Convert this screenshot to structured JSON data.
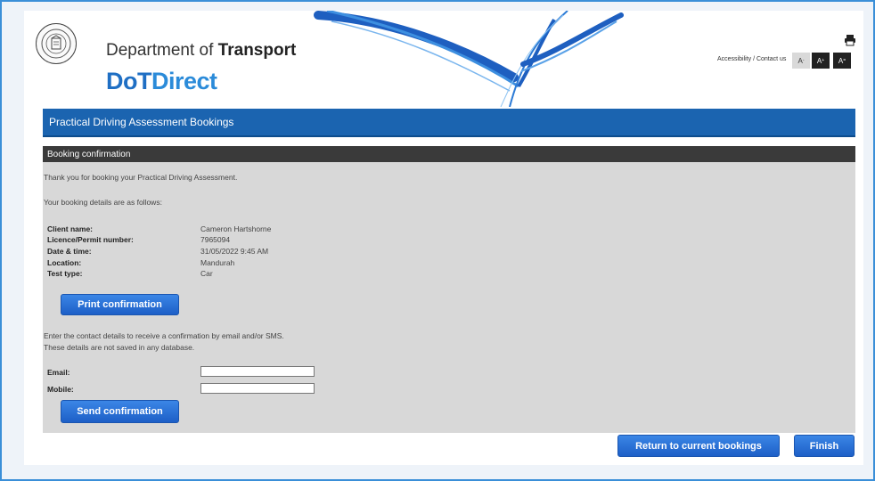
{
  "header": {
    "dept_prefix": "Department of ",
    "dept_bold": "Transport",
    "brand_dot": "DoT",
    "brand_direct": "Direct",
    "accessibility_link": "Accessibility / Contact us",
    "font_small": "A",
    "font_large": "A",
    "font_reset": "A"
  },
  "page_title": "Practical Driving Assessment Bookings",
  "section_title": "Booking confirmation",
  "intro": "Thank you for booking your Practical Driving Assessment.",
  "details_intro": "Your booking details are as follows:",
  "details": [
    {
      "label": "Client name:",
      "value": "Cameron Hartshorne"
    },
    {
      "label": "Licence/Permit number:",
      "value": "7965094"
    },
    {
      "label": "Date & time:",
      "value": "31/05/2022 9:45 AM"
    },
    {
      "label": "Location:",
      "value": "Mandurah"
    },
    {
      "label": "Test type:",
      "value": "Car"
    }
  ],
  "print_button": "Print confirmation",
  "contact_intro_1": "Enter the contact details to receive a confirmation by email and/or SMS.",
  "contact_intro_2": "These details are not saved in any database.",
  "email_label": "Email:",
  "email_value": "",
  "mobile_label": "Mobile:",
  "mobile_value": "",
  "send_button": "Send confirmation",
  "return_button": "Return to current bookings",
  "finish_button": "Finish",
  "colors": {
    "accent_blue": "#1b64b0",
    "button_blue": "#2b74d8",
    "section_header": "#3a3a3a",
    "content_bg": "#d8d8d8"
  }
}
